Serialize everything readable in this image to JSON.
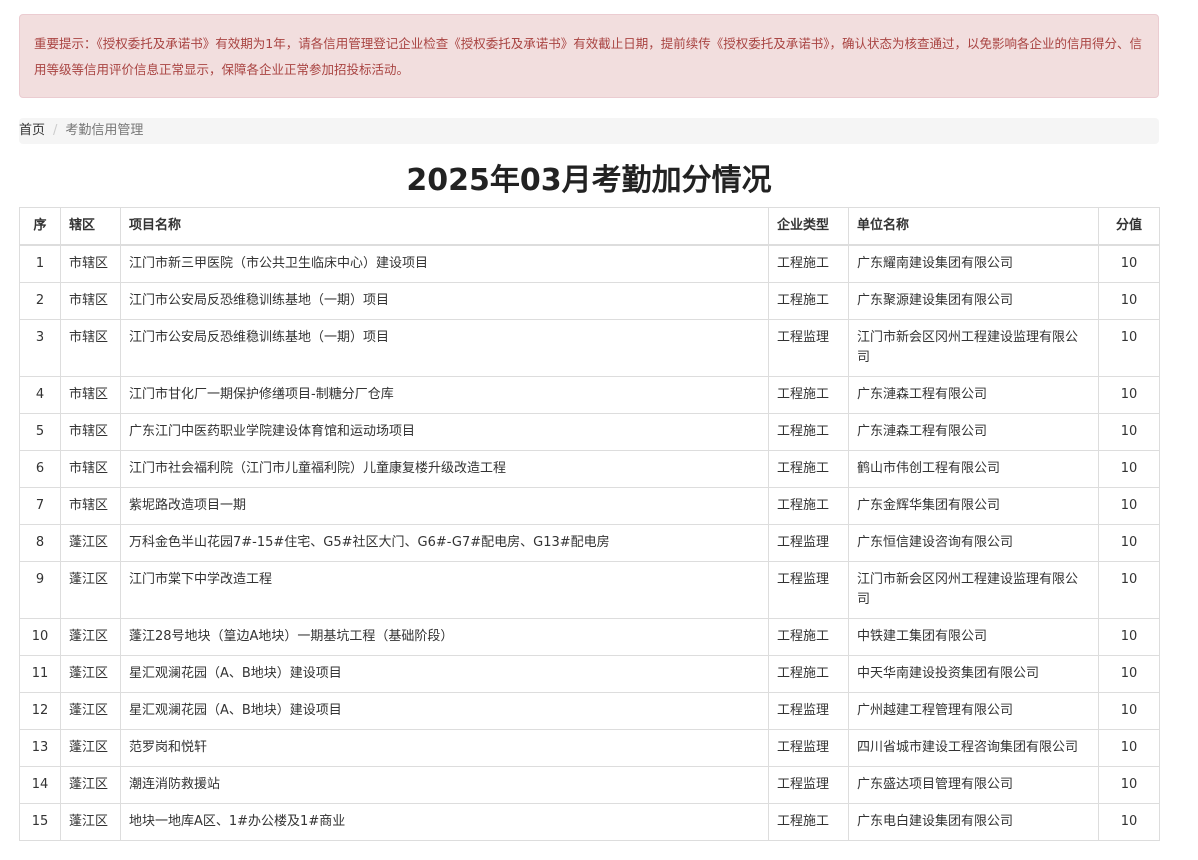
{
  "alert": {
    "text": "重要提示：《授权委托及承诺书》有效期为1年，请各信用管理登记企业检查《授权委托及承诺书》有效截止日期，提前续传《授权委托及承诺书》，确认状态为核查通过，以免影响各企业的信用得分、信用等级等信用评价信息正常显示，保障各企业正常参加招投标活动。"
  },
  "breadcrumb": {
    "home": "首页",
    "separator": "/",
    "current": "考勤信用管理"
  },
  "page_title": "2025年03月考勤加分情况",
  "table": {
    "headers": {
      "index": "序",
      "district": "辖区",
      "project": "项目名称",
      "type": "企业类型",
      "company": "单位名称",
      "score": "分值"
    },
    "rows": [
      {
        "index": "1",
        "district": "市辖区",
        "project": "江门市新三甲医院（市公共卫生临床中心）建设项目",
        "type": "工程施工",
        "company": "广东耀南建设集团有限公司",
        "score": "10"
      },
      {
        "index": "2",
        "district": "市辖区",
        "project": "江门市公安局反恐维稳训练基地（一期）项目",
        "type": "工程施工",
        "company": "广东聚源建设集团有限公司",
        "score": "10"
      },
      {
        "index": "3",
        "district": "市辖区",
        "project": "江门市公安局反恐维稳训练基地（一期）项目",
        "type": "工程监理",
        "company": "江门市新会区冈州工程建设监理有限公司",
        "score": "10"
      },
      {
        "index": "4",
        "district": "市辖区",
        "project": "江门市甘化厂一期保护修缮项目-制糖分厂仓库",
        "type": "工程施工",
        "company": "广东漣森工程有限公司",
        "score": "10"
      },
      {
        "index": "5",
        "district": "市辖区",
        "project": "广东江门中医药职业学院建设体育馆和运动场项目",
        "type": "工程施工",
        "company": "广东漣森工程有限公司",
        "score": "10"
      },
      {
        "index": "6",
        "district": "市辖区",
        "project": "江门市社会福利院（江门市儿童福利院）儿童康复楼升级改造工程",
        "type": "工程施工",
        "company": "鹤山市伟创工程有限公司",
        "score": "10"
      },
      {
        "index": "7",
        "district": "市辖区",
        "project": "紫坭路改造项目一期",
        "type": "工程施工",
        "company": "广东金辉华集团有限公司",
        "score": "10"
      },
      {
        "index": "8",
        "district": "蓬江区",
        "project": "万科金色半山花园7#-15#住宅、G5#社区大门、G6#-G7#配电房、G13#配电房",
        "type": "工程监理",
        "company": "广东恒信建设咨询有限公司",
        "score": "10"
      },
      {
        "index": "9",
        "district": "蓬江区",
        "project": "江门市棠下中学改造工程",
        "type": "工程监理",
        "company": "江门市新会区冈州工程建设监理有限公司",
        "score": "10"
      },
      {
        "index": "10",
        "district": "蓬江区",
        "project": "蓬江28号地块（篁边A地块）一期基坑工程（基础阶段）",
        "type": "工程施工",
        "company": "中铁建工集团有限公司",
        "score": "10"
      },
      {
        "index": "11",
        "district": "蓬江区",
        "project": "星汇观澜花园（A、B地块）建设项目",
        "type": "工程施工",
        "company": "中天华南建设投资集团有限公司",
        "score": "10"
      },
      {
        "index": "12",
        "district": "蓬江区",
        "project": "星汇观澜花园（A、B地块）建设项目",
        "type": "工程监理",
        "company": "广州越建工程管理有限公司",
        "score": "10"
      },
      {
        "index": "13",
        "district": "蓬江区",
        "project": "范罗岗和悦轩",
        "type": "工程监理",
        "company": "四川省城市建设工程咨询集团有限公司",
        "score": "10"
      },
      {
        "index": "14",
        "district": "蓬江区",
        "project": "潮连消防救援站",
        "type": "工程监理",
        "company": "广东盛达项目管理有限公司",
        "score": "10"
      },
      {
        "index": "15",
        "district": "蓬江区",
        "project": "地块一地库A区、1#办公楼及1#商业",
        "type": "工程施工",
        "company": "广东电白建设集团有限公司",
        "score": "10"
      }
    ]
  }
}
